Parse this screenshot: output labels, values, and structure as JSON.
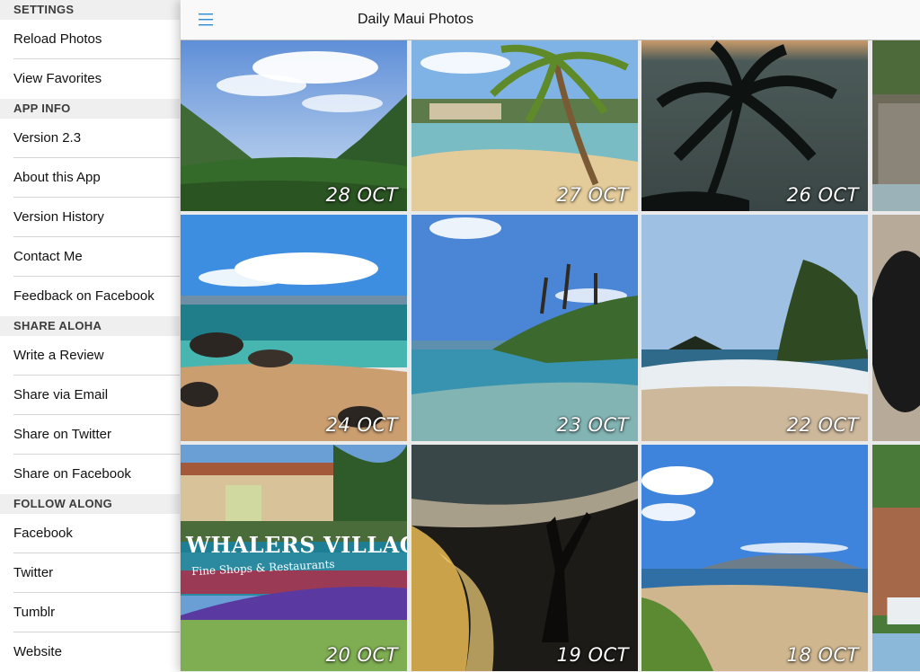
{
  "sidebar": {
    "sections": [
      {
        "header": "SETTINGS",
        "items": [
          "Reload Photos",
          "View Favorites"
        ]
      },
      {
        "header": "APP INFO",
        "items": [
          "Version 2.3",
          "About this App",
          "Version History",
          "Contact Me",
          "Feedback on Facebook"
        ]
      },
      {
        "header": "SHARE ALOHA",
        "items": [
          "Write a Review",
          "Share via Email",
          "Share on Twitter",
          "Share on Facebook"
        ]
      },
      {
        "header": "FOLLOW ALONG",
        "items": [
          "Facebook",
          "Twitter",
          "Tumblr",
          "Website"
        ]
      }
    ]
  },
  "navbar": {
    "title": "Daily Maui Photos",
    "menu_icon": "hamburger-menu-icon",
    "accent_color": "#2b8bd6"
  },
  "photos": [
    {
      "date": "28 OCT",
      "scene": "valley"
    },
    {
      "date": "27 OCT",
      "scene": "beach-palm"
    },
    {
      "date": "26 OCT",
      "scene": "palm-silhouette"
    },
    {
      "date": "",
      "scene": "partial-rocks"
    },
    {
      "date": "24 OCT",
      "scene": "rocky-coast"
    },
    {
      "date": "23 OCT",
      "scene": "cove-palms"
    },
    {
      "date": "22 OCT",
      "scene": "waves-cliff"
    },
    {
      "date": "",
      "scene": "partial-dark"
    },
    {
      "date": "20 OCT",
      "scene": "whalers-village",
      "sign_text": "WHALERS VILLAGE",
      "sign_subtext": "Fine Shops & Restaurants"
    },
    {
      "date": "19 OCT",
      "scene": "sunset-dancer"
    },
    {
      "date": "18 OCT",
      "scene": "beach-island"
    },
    {
      "date": "",
      "scene": "partial-pool"
    }
  ]
}
